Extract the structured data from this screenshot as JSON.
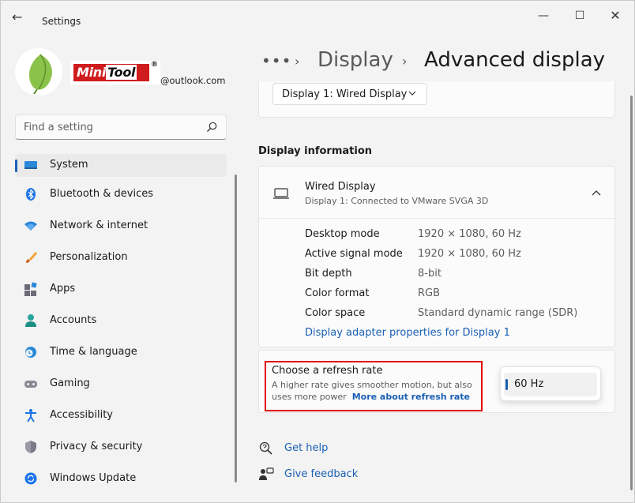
{
  "window": {
    "title": "Settings",
    "back_glyph": "←",
    "min_glyph": "—",
    "max_glyph": "☐",
    "close_glyph": "✕"
  },
  "account": {
    "logo_text_a": "Mini",
    "logo_text_b": "Tool",
    "logo_reg": "®",
    "email": "@outlook.com"
  },
  "search": {
    "placeholder": "Find a setting"
  },
  "nav": {
    "items": [
      {
        "label": "System",
        "icon": "system-icon",
        "active": true
      },
      {
        "label": "Bluetooth & devices",
        "icon": "bluetooth-icon"
      },
      {
        "label": "Network & internet",
        "icon": "wifi-icon"
      },
      {
        "label": "Personalization",
        "icon": "brush-icon"
      },
      {
        "label": "Apps",
        "icon": "apps-icon"
      },
      {
        "label": "Accounts",
        "icon": "person-icon"
      },
      {
        "label": "Time & language",
        "icon": "clock-globe-icon"
      },
      {
        "label": "Gaming",
        "icon": "gamepad-icon"
      },
      {
        "label": "Accessibility",
        "icon": "accessibility-icon"
      },
      {
        "label": "Privacy & security",
        "icon": "shield-icon"
      },
      {
        "label": "Windows Update",
        "icon": "update-icon"
      }
    ]
  },
  "breadcrumb": {
    "more": "•••",
    "sep": "›",
    "parent": "Display",
    "current": "Advanced display"
  },
  "display_select": {
    "value": "Display 1: Wired Display"
  },
  "display_info": {
    "section_title": "Display information",
    "name": "Wired Display",
    "subtitle": "Display 1: Connected to VMware SVGA 3D",
    "rows": [
      {
        "key": "Desktop mode",
        "value": "1920 × 1080, 60 Hz"
      },
      {
        "key": "Active signal mode",
        "value": "1920 × 1080, 60 Hz"
      },
      {
        "key": "Bit depth",
        "value": "8-bit"
      },
      {
        "key": "Color format",
        "value": "RGB"
      },
      {
        "key": "Color space",
        "value": "Standard dynamic range (SDR)"
      }
    ],
    "adapter_link": "Display adapter properties for Display 1"
  },
  "refresh": {
    "title": "Choose a refresh rate",
    "desc": "A higher rate gives smoother motion, but also uses more power",
    "link": "More about refresh rate",
    "selected": "60 Hz"
  },
  "help": {
    "get_help": "Get help",
    "give_feedback": "Give feedback"
  },
  "colors": {
    "accent": "#1a5fb4",
    "highlight_border": "#e00000",
    "brand_red": "#cf1c1c"
  }
}
